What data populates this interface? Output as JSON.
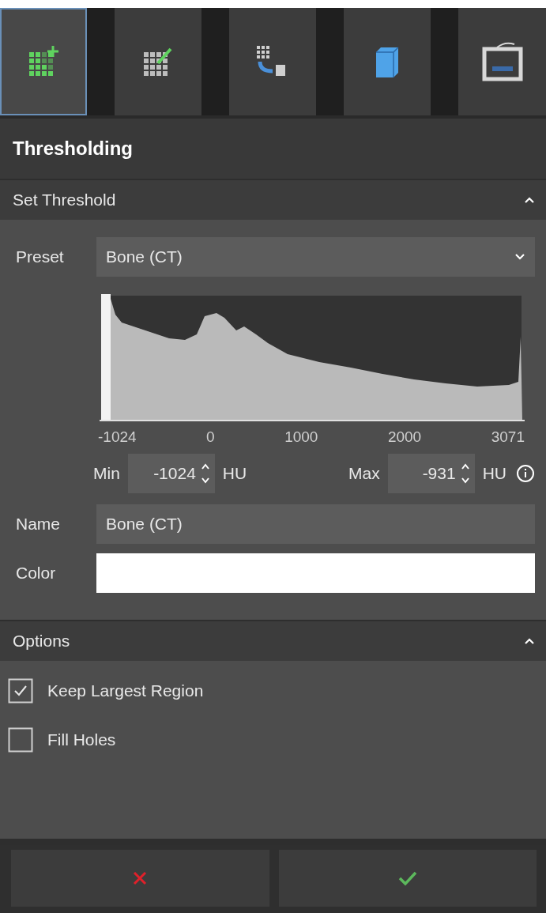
{
  "toolbar": [
    {
      "selected": true
    },
    {
      "selected": false
    },
    {
      "selected": false
    },
    {
      "selected": false
    },
    {
      "selected": false
    }
  ],
  "panel_title": "Thresholding",
  "set_threshold": {
    "title": "Set Threshold",
    "expanded": true,
    "preset": {
      "label": "Preset",
      "value": "Bone (CT)"
    },
    "histogram": {
      "axis_labels": [
        "-1024",
        "0",
        "1000",
        "2000",
        "3071"
      ]
    },
    "min": {
      "label": "Min",
      "value": "-1024",
      "unit": "HU"
    },
    "max": {
      "label": "Max",
      "value": "-931",
      "unit": "HU"
    },
    "name": {
      "label": "Name",
      "value": "Bone (CT)"
    },
    "color": {
      "label": "Color",
      "color": "#ffffff"
    }
  },
  "options": {
    "title": "Options",
    "expanded": true,
    "items": [
      {
        "label": "Keep Largest Region",
        "checked": true
      },
      {
        "label": "Fill Holes",
        "checked": false
      }
    ]
  },
  "footer": {
    "buttons": [
      {
        "kind": "cancel"
      },
      {
        "kind": "confirm"
      }
    ]
  }
}
